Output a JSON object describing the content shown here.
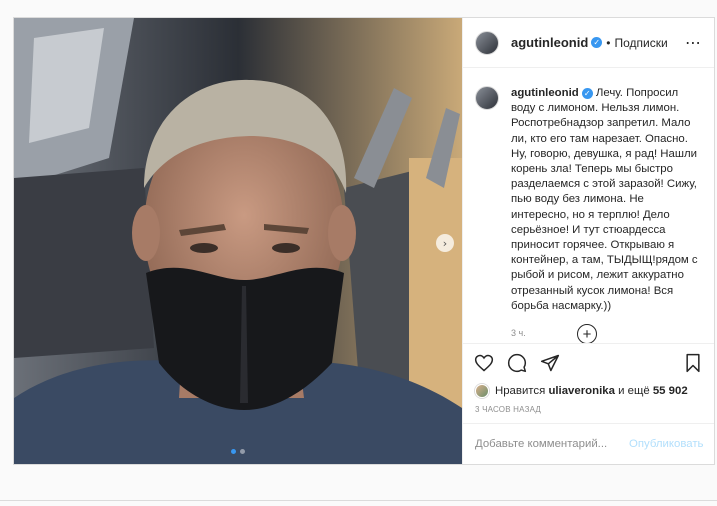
{
  "post": {
    "username": "agutinleonid",
    "separator": "•",
    "follow_status": "Подписки",
    "more_icon": "⋯",
    "caption": "Лечу. Попросил воду с лимоном. Нельзя лимон. Роспотребнадзор запретил. Мало ли, кто его там нарезает. Опасно. Ну, говорю, девушка, я рад! Нашли корень зла! Теперь мы быстро разделаемся с этой заразой! Сижу, пью воду без лимона. Не интересно, но я терплю! Дело серьёзное! И тут стюардесса приносит горячее. Открываю я контейнер, а там, ТЫДЫЩ!рядом с рыбой и рисом, лежит аккуратно отрезанный кусок лимона! Вся борьба насмарку.))",
    "caption_time": "3 ч.",
    "load_more_icon": "+",
    "likes": {
      "prefix": "Нравится",
      "liker": "uliaveronika",
      "middle": "и ещё",
      "count": "55 902"
    },
    "time_ago": "3 ЧАСОВ НАЗАД",
    "comment_placeholder": "Добавьте комментарий...",
    "publish_label": "Опубликовать",
    "next_arrow": "›"
  },
  "icons": {
    "like": "heart-icon",
    "comment": "comment-icon",
    "share": "paper-plane-icon",
    "save": "bookmark-icon"
  },
  "colors": {
    "verified": "#3897f0",
    "publish_disabled": "#b2dffc",
    "text": "#262626",
    "muted": "#8e8e8e"
  },
  "carousel": {
    "slides": 2,
    "active": 1
  }
}
